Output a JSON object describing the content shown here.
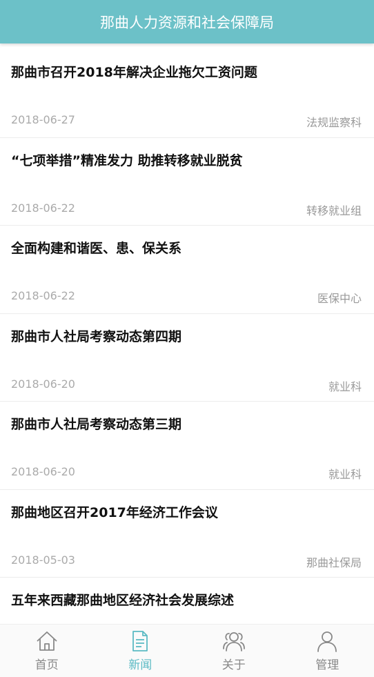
{
  "header": {
    "title": "那曲人力资源和社会保障局"
  },
  "news": [
    {
      "title": "那曲市召开2018年解决企业拖欠工资问题",
      "date": "2018-06-27",
      "dept": "法规监察科"
    },
    {
      "title": "“七项举措”精准发力 助推转移就业脱贫",
      "date": "2018-06-22",
      "dept": "转移就业组"
    },
    {
      "title": "全面构建和谐医、患、保关系",
      "date": "2018-06-22",
      "dept": "医保中心"
    },
    {
      "title": "那曲市人社局考察动态第四期",
      "date": "2018-06-20",
      "dept": "就业科"
    },
    {
      "title": "那曲市人社局考察动态第三期",
      "date": "2018-06-20",
      "dept": "就业科"
    },
    {
      "title": "那曲地区召开2017年经济工作会议",
      "date": "2018-05-03",
      "dept": "那曲社保局"
    },
    {
      "title": "五年来西藏那曲地区经济社会发展综述",
      "date": "",
      "dept": ""
    }
  ],
  "tabbar": {
    "tabs": [
      {
        "label": "首页",
        "icon": "home-icon"
      },
      {
        "label": "新闻",
        "icon": "news-document-icon",
        "active": true
      },
      {
        "label": "关于",
        "icon": "people-group-icon"
      },
      {
        "label": "管理",
        "icon": "user-icon"
      }
    ]
  },
  "colors": {
    "header_bg": "#6cc1c8",
    "active_tab": "#5bbac4",
    "inactive_tab": "#888888"
  }
}
